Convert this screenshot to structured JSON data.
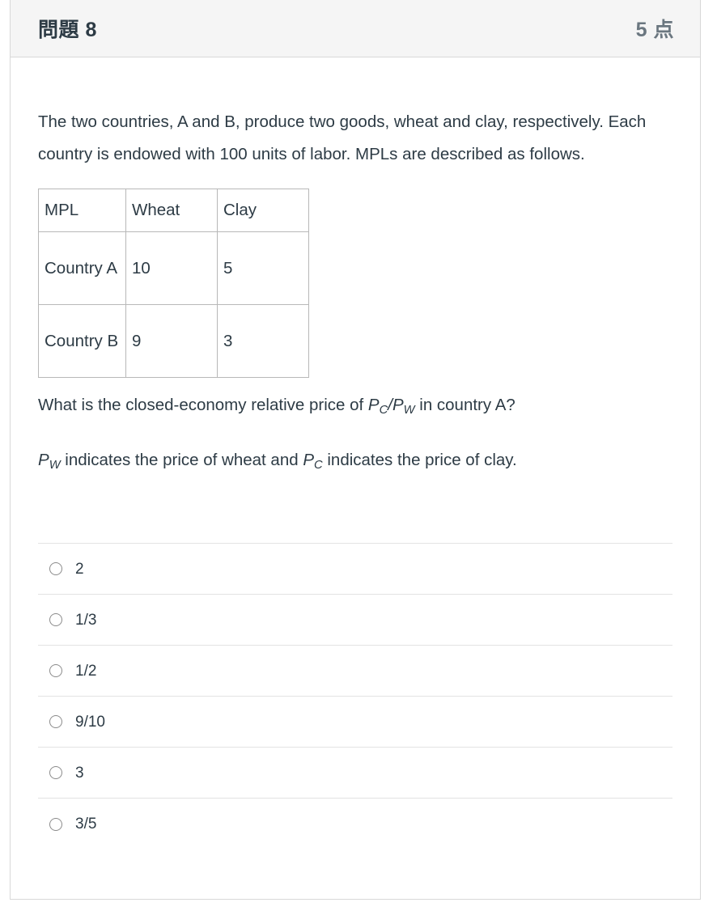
{
  "header": {
    "title": "問題 8",
    "points": "5 点"
  },
  "body": {
    "intro": "The two countries, A and B, produce two goods, wheat and clay, respectively. Each country is endowed with 100 units of labor. MPLs are described as follows.",
    "table": {
      "headers": [
        "MPL",
        "Wheat",
        "Clay"
      ],
      "rows": [
        {
          "label": "Country A",
          "wheat": "10",
          "clay": "5"
        },
        {
          "label": "Country B",
          "wheat": "9",
          "clay": "3"
        }
      ]
    },
    "question": {
      "lead": "What is the closed-economy relative price of ",
      "symbol_numerator_base": "P",
      "symbol_numerator_sub": "C",
      "slash": "/",
      "symbol_denominator_base": "P",
      "symbol_denominator_sub": "W",
      "tail": " in country A?"
    },
    "definition": {
      "pw_base": "P",
      "pw_sub": "W",
      "mid_one": " indicates the price of wheat and ",
      "pc_base": "P",
      "pc_sub": "C",
      "mid_two": " indicates the price of clay."
    }
  },
  "answers": {
    "options": [
      {
        "label": "2",
        "selected": false
      },
      {
        "label": "1/3",
        "selected": false
      },
      {
        "label": "1/2",
        "selected": false
      },
      {
        "label": "9/10",
        "selected": false
      },
      {
        "label": "3",
        "selected": false
      },
      {
        "label": "3/5",
        "selected": false
      }
    ]
  },
  "colors": {
    "text": "#2d3b45",
    "muted": "#6b7780",
    "card_border": "#d8d8d8",
    "header_bg": "#f5f5f5",
    "divider": "#e3e3e3",
    "table_border": "#b8b8b8",
    "radio_border": "#8b8b8b"
  }
}
